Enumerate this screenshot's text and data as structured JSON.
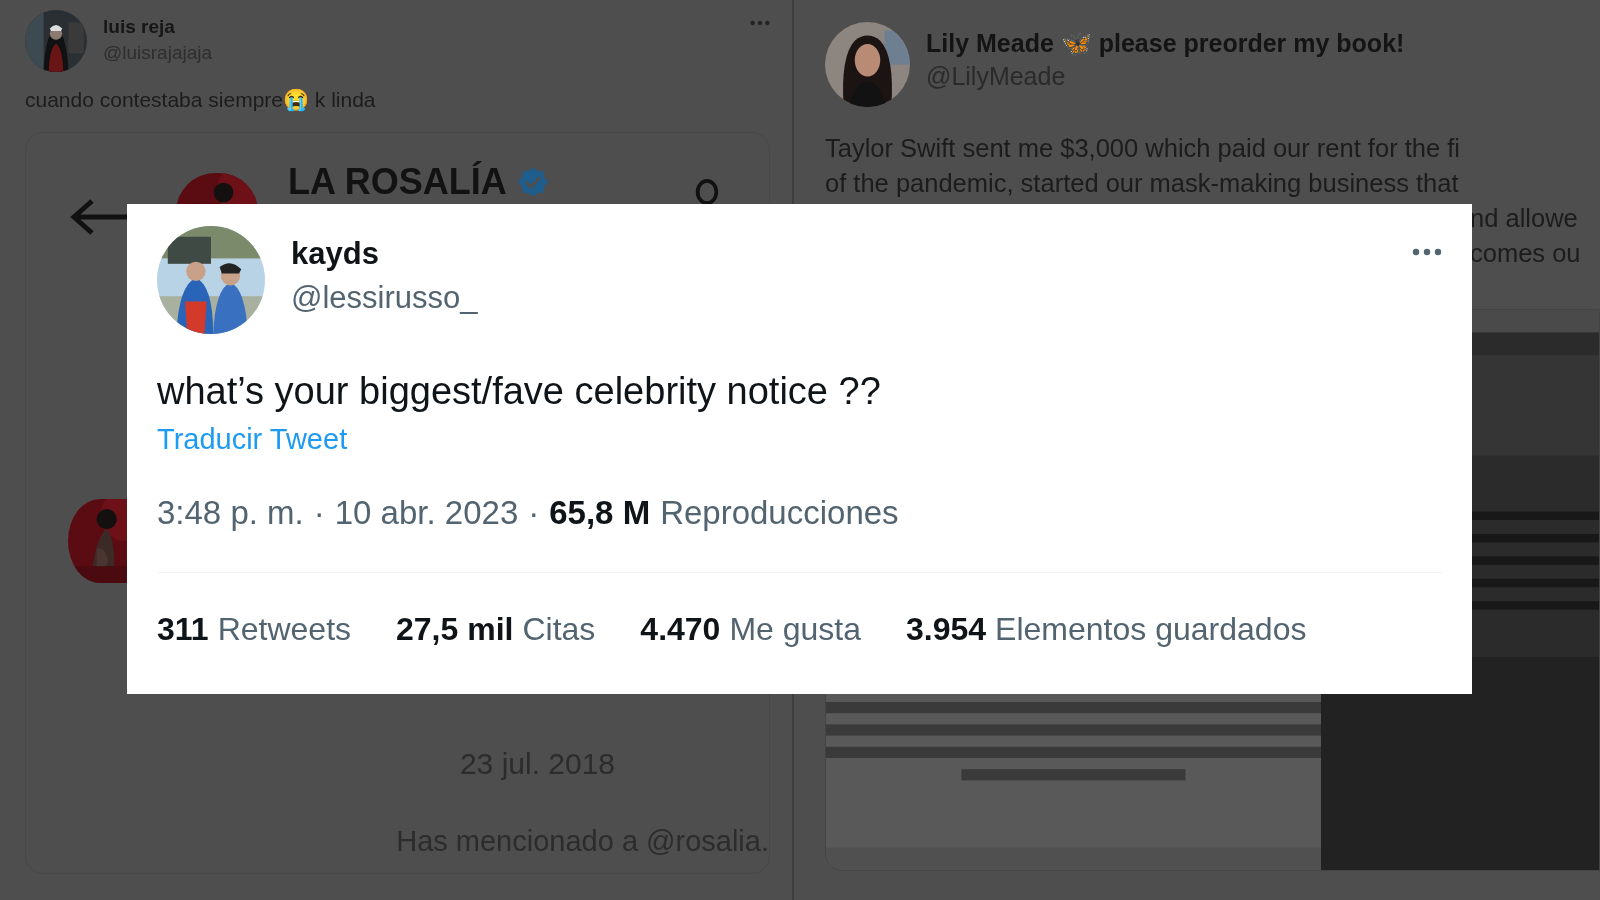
{
  "left_tweet": {
    "name": "luis reja",
    "handle": "@luisrajajaja",
    "text": "cuando contestaba siempre😭 k linda",
    "quoted": {
      "profile_name": "LA ROSALÍA",
      "verified": true,
      "date": "23 jul. 2018",
      "mention_notice": "Has mencionado a @rosalia."
    }
  },
  "right_tweet": {
    "name": "Lily Meade 🦋 please preorder my book!",
    "handle": "@LilyMeade",
    "text_lines": [
      "Taylor Swift sent me $3,000 which paid our rent for the fi",
      "of the pandemic, started our mask-making business that"
    ],
    "visible_fragments": [
      "nd allowe",
      "comes ou"
    ]
  },
  "focus_tweet": {
    "name": "kayds",
    "handle": "@lessirusso_",
    "text": "what’s your biggest/fave celebrity notice ??",
    "translate": "Traducir Tweet",
    "separator": "·",
    "time": "3:48 p. m.",
    "date": "10 abr. 2023",
    "views_count": "65,8 M",
    "views_label": "Reproducciones",
    "stats": [
      {
        "count": "311",
        "label": "Retweets"
      },
      {
        "count": "27,5 mil",
        "label": "Citas"
      },
      {
        "count": "4.470",
        "label": "Me gusta"
      },
      {
        "count": "3.954",
        "label": "Elementos guardados"
      }
    ]
  }
}
